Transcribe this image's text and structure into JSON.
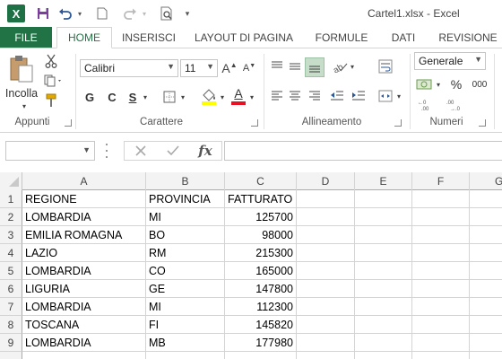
{
  "app": {
    "title": "Cartel1.xlsx - Excel",
    "logo_letter": "X",
    "accent": "#217346"
  },
  "qat": {
    "icons": [
      "save-icon",
      "undo-icon",
      "redo-icon",
      "new-icon",
      "print-preview-icon",
      "customize-icon"
    ]
  },
  "tabs": {
    "file": "FILE",
    "items": [
      "HOME",
      "INSERISCI",
      "LAYOUT DI PAGINA",
      "FORMULE",
      "DATI",
      "REVISIONE"
    ],
    "active": "HOME"
  },
  "ribbon": {
    "clipboard": {
      "label": "Appunti",
      "paste_label": "Incolla"
    },
    "font": {
      "label": "Carattere",
      "font_name": "Calibri",
      "font_size": "11",
      "grow": "A",
      "shrink": "A",
      "bold": "G",
      "italic": "C",
      "underline": "S",
      "font_color_letter": "A",
      "font_color": "#e81123"
    },
    "alignment": {
      "label": "Allineamento"
    },
    "number": {
      "label": "Numeri",
      "format": "Generale",
      "percent": "%",
      "comma": "000"
    }
  },
  "formula_bar": {
    "name_box": "",
    "fx": "fx",
    "formula": ""
  },
  "sheet": {
    "columns": [
      "A",
      "B",
      "C",
      "D",
      "E",
      "F",
      "G"
    ],
    "rows": [
      {
        "n": "1",
        "a": "REGIONE",
        "b": "PROVINCIA",
        "c": "FATTURATO"
      },
      {
        "n": "2",
        "a": "LOMBARDIA",
        "b": "MI",
        "c": "125700"
      },
      {
        "n": "3",
        "a": "EMILIA ROMAGNA",
        "b": "BO",
        "c": "98000"
      },
      {
        "n": "4",
        "a": "LAZIO",
        "b": "RM",
        "c": "215300"
      },
      {
        "n": "5",
        "a": "LOMBARDIA",
        "b": "CO",
        "c": "165000"
      },
      {
        "n": "6",
        "a": "LIGURIA",
        "b": "GE",
        "c": "147800"
      },
      {
        "n": "7",
        "a": "LOMBARDIA",
        "b": "MI",
        "c": "112300"
      },
      {
        "n": "8",
        "a": "TOSCANA",
        "b": "FI",
        "c": "145820"
      },
      {
        "n": "9",
        "a": "LOMBARDIA",
        "b": "MB",
        "c": "177980"
      }
    ]
  }
}
